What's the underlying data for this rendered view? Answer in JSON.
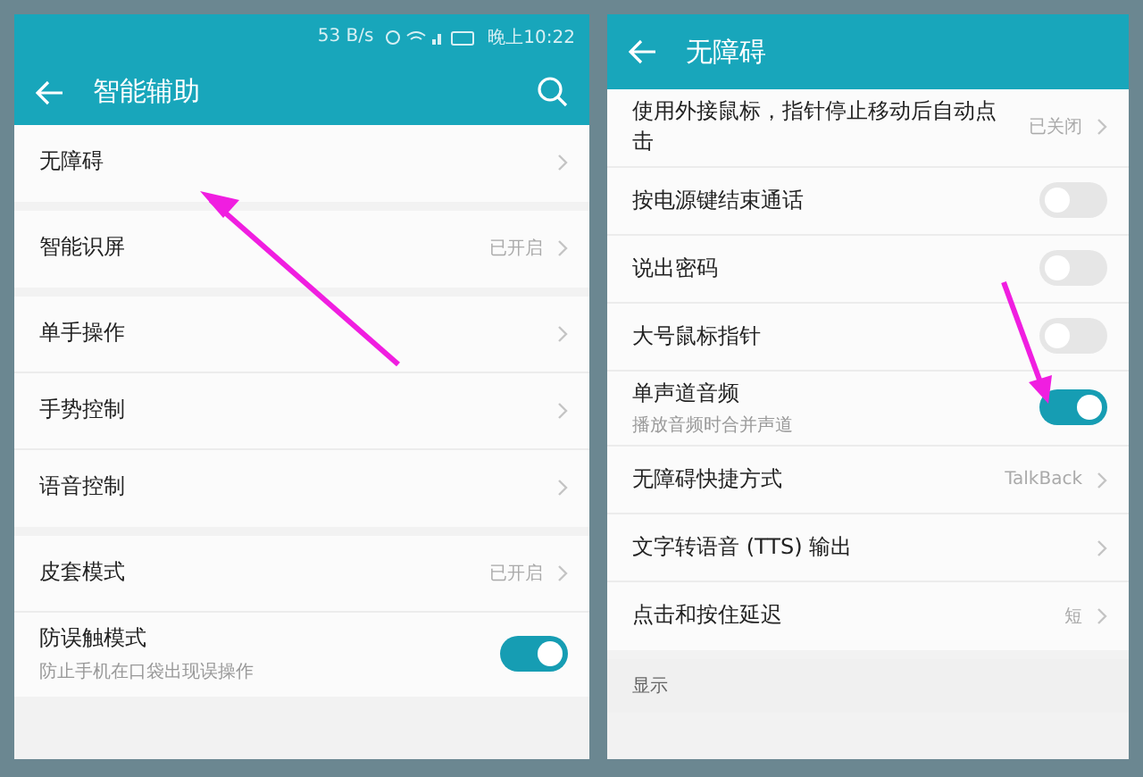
{
  "screens": [
    {
      "status_bar": {
        "speed": "53 B/s",
        "time": "晚上10:22"
      },
      "header": {
        "title": "智能辅助",
        "actions": [
          {
            "kind": "search"
          }
        ]
      },
      "groups": [
        {
          "items": [
            {
              "kind": "link",
              "label": "无障碍"
            }
          ]
        },
        {
          "items": [
            {
              "kind": "link",
              "label": "智能识屏",
              "value": "已开启"
            }
          ]
        },
        {
          "items": [
            {
              "kind": "link",
              "label": "单手操作"
            },
            {
              "kind": "link",
              "label": "手势控制"
            },
            {
              "kind": "link",
              "label": "语音控制"
            }
          ]
        },
        {
          "items": [
            {
              "kind": "link",
              "label": "皮套模式",
              "value": "已开启"
            },
            {
              "kind": "toggle",
              "label": "防误触模式",
              "subtitle": "防止手机在口袋出现误操作",
              "on": true
            }
          ]
        }
      ]
    },
    {
      "header": {
        "title": "无障碍"
      },
      "groups": [
        {
          "items": [
            {
              "kind": "link",
              "label": "使用外接鼠标，指针停止移动后自动点击",
              "value": "已关闭"
            },
            {
              "kind": "toggle",
              "label": "按电源键结束通话",
              "on": false
            },
            {
              "kind": "toggle",
              "label": "说出密码",
              "on": false
            },
            {
              "kind": "toggle",
              "label": "大号鼠标指针",
              "on": false
            },
            {
              "kind": "toggle",
              "label": "单声道音频",
              "subtitle": "播放音频时合并声道",
              "on": true
            },
            {
              "kind": "link",
              "label": "无障碍快捷方式",
              "value": "TalkBack"
            },
            {
              "kind": "link",
              "label": "文字转语音 (TTS) 输出"
            },
            {
              "kind": "link",
              "label": "点击和按住延迟",
              "value": "短"
            }
          ]
        },
        {
          "heading": "显示"
        }
      ]
    }
  ]
}
